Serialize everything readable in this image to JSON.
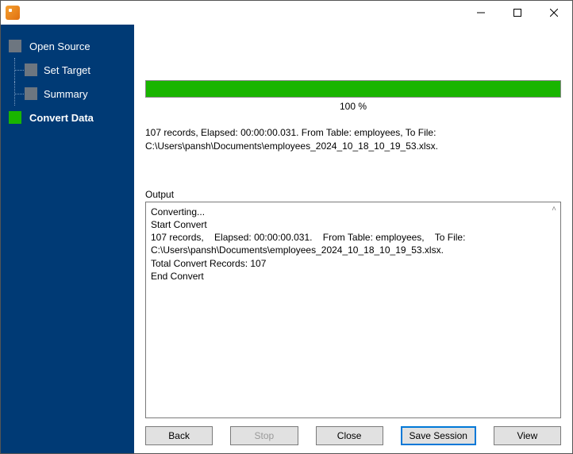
{
  "sidebar": {
    "items": [
      {
        "label": "Open Source"
      },
      {
        "label": "Set Target"
      },
      {
        "label": "Summary"
      },
      {
        "label": "Convert Data"
      }
    ]
  },
  "progress": {
    "percent_text": "100 %",
    "fill_pct": 100
  },
  "status": {
    "line1": "107 records,    Elapsed: 00:00:00.031.    From Table: employees,    To File:",
    "line2": "C:\\Users\\pansh\\Documents\\employees_2024_10_18_10_19_53.xlsx."
  },
  "output": {
    "label": "Output",
    "text": "Converting...\nStart Convert\n107 records,    Elapsed: 00:00:00.031.    From Table: employees,    To File: C:\\Users\\pansh\\Documents\\employees_2024_10_18_10_19_53.xlsx.\nTotal Convert Records: 107\nEnd Convert"
  },
  "buttons": {
    "back": "Back",
    "stop": "Stop",
    "close": "Close",
    "save_session": "Save Session",
    "view": "View"
  }
}
